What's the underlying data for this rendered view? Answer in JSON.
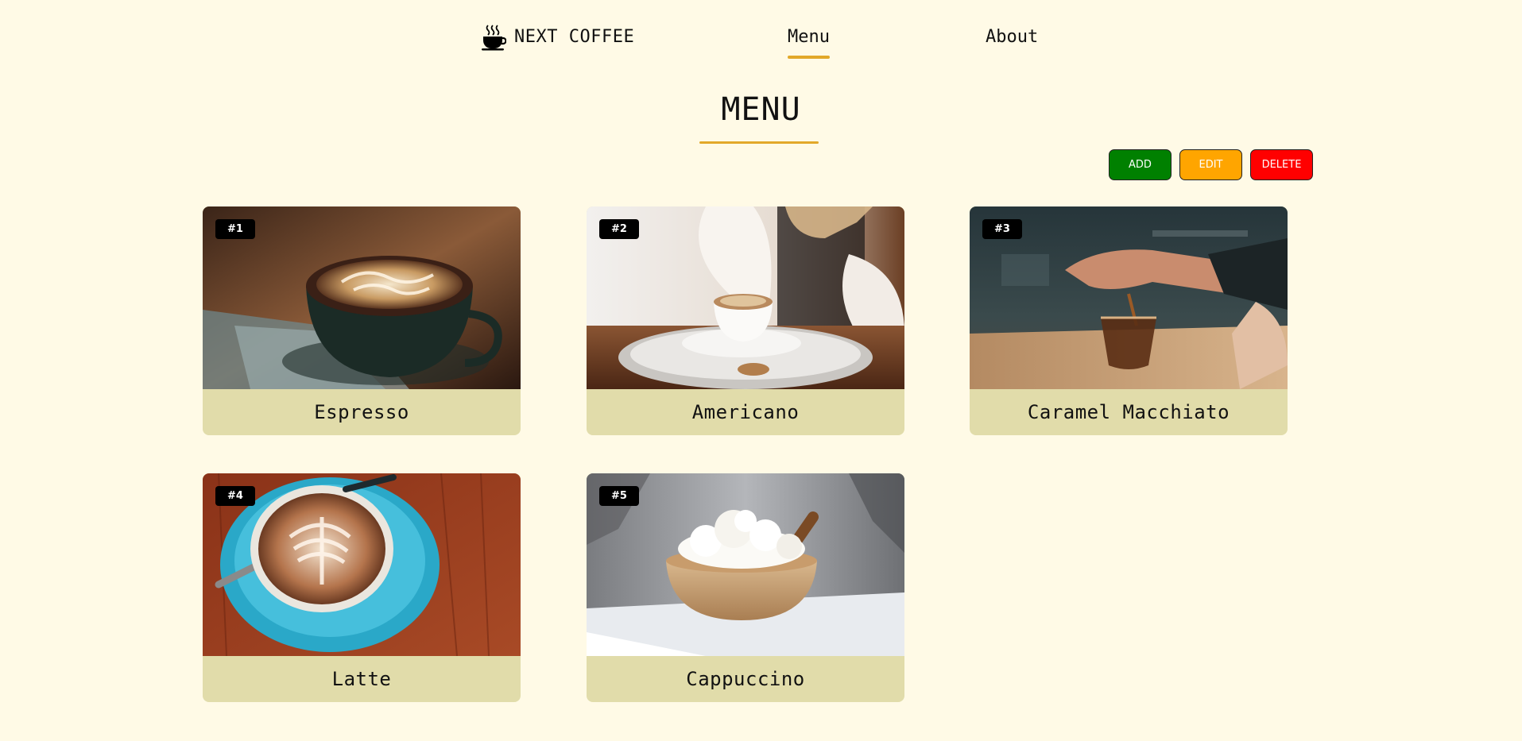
{
  "nav": {
    "brand": "NEXT COFFEE",
    "brand_icon": "coffee-cup-icon",
    "links": [
      {
        "label": "Menu",
        "active": true
      },
      {
        "label": "About",
        "active": false
      }
    ],
    "accent_color": "#e2a82a"
  },
  "page": {
    "title": "MENU",
    "background": "#fffae6"
  },
  "actions": {
    "add": "ADD",
    "edit": "EDIT",
    "delete": "DELETE",
    "colors": {
      "add": "#008000",
      "edit": "#ffa500",
      "delete": "#ff0000"
    }
  },
  "items": [
    {
      "badge": "#1",
      "name": "Espresso"
    },
    {
      "badge": "#2",
      "name": "Americano"
    },
    {
      "badge": "#3",
      "name": "Caramel Macchiato"
    },
    {
      "badge": "#4",
      "name": "Latte"
    },
    {
      "badge": "#5",
      "name": "Cappuccino"
    }
  ]
}
